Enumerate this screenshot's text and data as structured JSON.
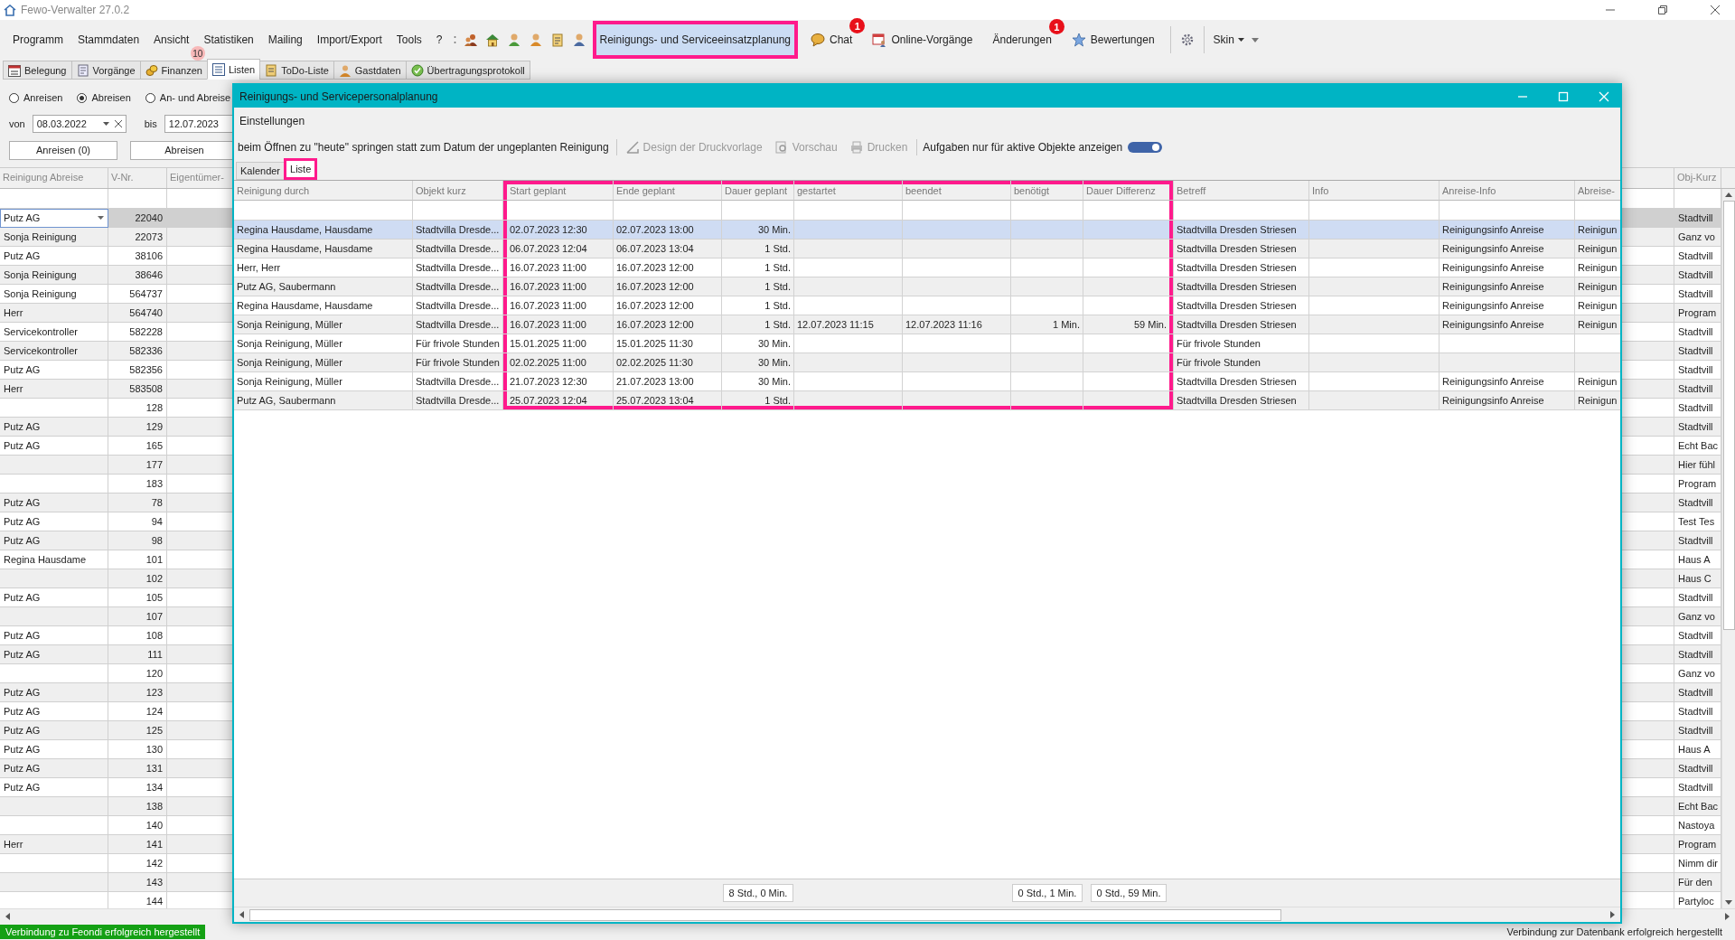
{
  "window": {
    "title": "Fewo-Verwalter 27.0.2"
  },
  "menu": [
    "Programm",
    "Stammdaten",
    "Ansicht",
    "Statistiken",
    "Mailing",
    "Import/Export",
    "Tools",
    "?"
  ],
  "tool_buttons": [
    {
      "label": "Reinigungs- und Serviceeinsatzplanung",
      "selected": true,
      "highlighted": true
    },
    {
      "label": "Chat",
      "selected": false,
      "highlighted": false,
      "badge": "1"
    },
    {
      "label": "Online-Vorgänge",
      "selected": false,
      "highlighted": false
    },
    {
      "label": "Änderungen",
      "selected": false,
      "highlighted": false,
      "badge": "1"
    },
    {
      "label": "Bewertungen",
      "selected": false,
      "highlighted": false
    }
  ],
  "skin": "Skin",
  "tabs": [
    {
      "label": "Belegung",
      "selected": false
    },
    {
      "label": "Vorgänge",
      "selected": false
    },
    {
      "label": "Finanzen",
      "selected": false,
      "badge": "10"
    },
    {
      "label": "Listen",
      "selected": true
    },
    {
      "label": "ToDo-Liste",
      "selected": false
    },
    {
      "label": "Gastdaten",
      "selected": false
    },
    {
      "label": "Übertragungsprotokoll",
      "selected": false
    }
  ],
  "filter": {
    "radios": [
      {
        "label": "Anreisen",
        "selected": false
      },
      {
        "label": "Abreisen",
        "selected": true
      },
      {
        "label": "An- und Abreise",
        "selected": false
      }
    ],
    "from_label": "von",
    "from": "08.03.2022",
    "to_label": "bis",
    "to": "12.07.2023",
    "buttons": [
      "Anreisen (0)",
      "Abreisen"
    ]
  },
  "list": {
    "columns": [
      "Reinigung Abreise",
      "V-Nr.",
      "Eigentümer-",
      "Obj-Kurz"
    ],
    "rows": [
      {
        "reinigung": "Putz AG",
        "v_nr": "22040",
        "obj_kurz": "Stadtvill",
        "selected": true
      },
      {
        "reinigung": "Sonja Reinigung",
        "v_nr": "22073",
        "obj_kurz": "Ganz vo",
        "selected": false
      },
      {
        "reinigung": "Putz AG",
        "v_nr": "38106",
        "obj_kurz": "Stadtvill",
        "selected": false
      },
      {
        "reinigung": "Sonja Reinigung",
        "v_nr": "38646",
        "obj_kurz": "Stadtvill",
        "selected": false
      },
      {
        "reinigung": "Sonja Reinigung",
        "v_nr": "564737",
        "obj_kurz": "Stadtvill",
        "selected": false
      },
      {
        "reinigung": "Herr",
        "v_nr": "564740",
        "obj_kurz": "Program",
        "selected": false
      },
      {
        "reinigung": "Servicekontroller",
        "v_nr": "582228",
        "obj_kurz": "Stadtvill",
        "selected": false
      },
      {
        "reinigung": "Servicekontroller",
        "v_nr": "582336",
        "obj_kurz": "Stadtvill",
        "selected": false
      },
      {
        "reinigung": "Putz AG",
        "v_nr": "582356",
        "obj_kurz": "Stadtvill",
        "selected": false
      },
      {
        "reinigung": "Herr",
        "v_nr": "583508",
        "obj_kurz": "Stadtvill",
        "selected": false
      },
      {
        "v_nr": "128",
        "obj_kurz": "Stadtvill",
        "selected": false
      },
      {
        "reinigung": "Putz AG",
        "v_nr": "129",
        "obj_kurz": "Stadtvill",
        "selected": false
      },
      {
        "reinigung": "Putz AG",
        "v_nr": "165",
        "obj_kurz": "Echt Bac",
        "selected": false
      },
      {
        "v_nr": "177",
        "obj_kurz": "Hier fühl",
        "selected": false
      },
      {
        "v_nr": "183",
        "obj_kurz": "Program",
        "selected": false
      },
      {
        "reinigung": "Putz AG",
        "v_nr": "78",
        "obj_kurz": "Stadtvill",
        "selected": false
      },
      {
        "reinigung": "Putz AG",
        "v_nr": "94",
        "obj_kurz": "Test Tes",
        "selected": false
      },
      {
        "reinigung": "Putz AG",
        "v_nr": "98",
        "obj_kurz": "Stadtvill",
        "selected": false
      },
      {
        "reinigung": "Regina Hausdame",
        "v_nr": "101",
        "obj_kurz": "Haus A",
        "selected": false
      },
      {
        "v_nr": "102",
        "obj_kurz": "Haus C",
        "selected": false
      },
      {
        "reinigung": "Putz AG",
        "v_nr": "105",
        "obj_kurz": "Stadtvill",
        "selected": false
      },
      {
        "v_nr": "107",
        "obj_kurz": "Ganz vo",
        "selected": false
      },
      {
        "reinigung": "Putz AG",
        "v_nr": "108",
        "obj_kurz": "Stadtvill",
        "selected": false
      },
      {
        "reinigung": "Putz AG",
        "v_nr": "111",
        "obj_kurz": "Stadtvill",
        "selected": false
      },
      {
        "v_nr": "120",
        "obj_kurz": "Ganz vo",
        "selected": false
      },
      {
        "reinigung": "Putz AG",
        "v_nr": "123",
        "obj_kurz": "Stadtvill",
        "selected": false
      },
      {
        "reinigung": "Putz AG",
        "v_nr": "124",
        "obj_kurz": "Stadtvill",
        "selected": false
      },
      {
        "reinigung": "Putz AG",
        "v_nr": "125",
        "obj_kurz": "Stadtvill",
        "selected": false
      },
      {
        "reinigung": "Putz AG",
        "v_nr": "130",
        "obj_kurz": "Haus A",
        "selected": false
      },
      {
        "reinigung": "Putz AG",
        "v_nr": "131",
        "obj_kurz": "Stadtvill",
        "selected": false
      },
      {
        "reinigung": "Putz AG",
        "v_nr": "134",
        "obj_kurz": "Stadtvill",
        "selected": false
      },
      {
        "v_nr": "138",
        "obj_kurz": "Echt Bac",
        "selected": false
      },
      {
        "v_nr": "140",
        "obj_kurz": "Nastoya",
        "selected": false
      },
      {
        "reinigung": "Herr",
        "v_nr": "141",
        "obj_kurz": "Program",
        "selected": false
      },
      {
        "v_nr": "142",
        "obj_kurz": "Nimm dir",
        "selected": false
      },
      {
        "v_nr": "143",
        "obj_kurz": "Für den",
        "selected": false
      },
      {
        "v_nr": "144",
        "obj_kurz": "Partyloc",
        "selected": false
      }
    ]
  },
  "dialog": {
    "title": "Reinigungs- und Servicepersonalplanung",
    "menu": [
      "Einstellungen"
    ],
    "jump_button": "beim Öffnen zu \"heute\" springen statt zum Datum der ungeplanten Reinigung",
    "print_buttons": [
      {
        "label": "Design der Druckvorlage",
        "disabled": true
      },
      {
        "label": "Vorschau",
        "disabled": true
      },
      {
        "label": "Drucken",
        "disabled": true
      }
    ],
    "active_switch": {
      "label": "Aufgaben nur für aktive Objekte anzeigen",
      "on": true
    },
    "tabs": [
      {
        "label": "Kalender",
        "selected": false,
        "highlighted": false
      },
      {
        "label": "Liste",
        "selected": true,
        "highlighted": true
      }
    ],
    "columns": [
      {
        "label": "Reinigung durch",
        "highlighted": false
      },
      {
        "label": "Objekt kurz",
        "highlighted": false
      },
      {
        "label": "Start geplant",
        "highlighted": true
      },
      {
        "label": "Ende geplant",
        "highlighted": true
      },
      {
        "label": "Dauer geplant",
        "highlighted": true,
        "total": "8 Std., 0 Min."
      },
      {
        "label": "gestartet",
        "highlighted": true
      },
      {
        "label": "beendet",
        "highlighted": true
      },
      {
        "label": "benötigt",
        "highlighted": true,
        "total": "0 Std., 1 Min."
      },
      {
        "label": "Dauer Differenz",
        "highlighted": true,
        "total": "0 Std., 59 Min."
      },
      {
        "label": "Betreff",
        "highlighted": false
      },
      {
        "label": "Info",
        "highlighted": false
      },
      {
        "label": "Anreise-Info",
        "highlighted": false
      },
      {
        "label": "Abreise-",
        "highlighted": false
      }
    ],
    "rows": [
      {
        "selected": true,
        "cells": [
          "Regina Hausdame, Hausdame",
          "Stadtvilla Dresde...",
          "02.07.2023 12:30",
          "02.07.2023 13:00",
          "30 Min.",
          null,
          null,
          null,
          null,
          "Stadtvilla Dresden Striesen",
          null,
          "Reinigungsinfo Anreise",
          "Reinigun"
        ]
      },
      {
        "selected": false,
        "cells": [
          "Regina Hausdame, Hausdame",
          "Stadtvilla Dresde...",
          "06.07.2023 12:04",
          "06.07.2023 13:04",
          "1 Std.",
          null,
          null,
          null,
          null,
          "Stadtvilla Dresden Striesen",
          null,
          "Reinigungsinfo Anreise",
          "Reinigun"
        ]
      },
      {
        "selected": false,
        "cells": [
          "Herr, Herr",
          "Stadtvilla Dresde...",
          "16.07.2023 11:00",
          "16.07.2023 12:00",
          "1 Std.",
          null,
          null,
          null,
          null,
          "Stadtvilla Dresden Striesen",
          null,
          "Reinigungsinfo Anreise",
          "Reinigun"
        ]
      },
      {
        "selected": false,
        "cells": [
          "Putz AG, Saubermann",
          "Stadtvilla Dresde...",
          "16.07.2023 11:00",
          "16.07.2023 12:00",
          "1 Std.",
          null,
          null,
          null,
          null,
          "Stadtvilla Dresden Striesen",
          null,
          "Reinigungsinfo Anreise",
          "Reinigun"
        ]
      },
      {
        "selected": false,
        "cells": [
          "Regina Hausdame, Hausdame",
          "Stadtvilla Dresde...",
          "16.07.2023 11:00",
          "16.07.2023 12:00",
          "1 Std.",
          null,
          null,
          null,
          null,
          "Stadtvilla Dresden Striesen",
          null,
          "Reinigungsinfo Anreise",
          "Reinigun"
        ]
      },
      {
        "selected": false,
        "cells": [
          "Sonja Reinigung, Müller",
          "Stadtvilla Dresde...",
          "16.07.2023 11:00",
          "16.07.2023 12:00",
          "1 Std.",
          "12.07.2023 11:15",
          "12.07.2023 11:16",
          "1 Min.",
          "59 Min.",
          "Stadtvilla Dresden Striesen",
          null,
          "Reinigungsinfo Anreise",
          "Reinigun"
        ]
      },
      {
        "selected": false,
        "cells": [
          "Sonja Reinigung, Müller",
          "Für frivole Stunden",
          "15.01.2025 11:00",
          "15.01.2025 11:30",
          "30 Min.",
          null,
          null,
          null,
          null,
          "Für frivole Stunden",
          null,
          null,
          null
        ]
      },
      {
        "selected": false,
        "cells": [
          "Sonja Reinigung, Müller",
          "Für frivole Stunden",
          "02.02.2025 11:00",
          "02.02.2025 11:30",
          "30 Min.",
          null,
          null,
          null,
          null,
          "Für frivole Stunden",
          null,
          null,
          null
        ]
      },
      {
        "selected": false,
        "cells": [
          "Sonja Reinigung, Müller",
          "Stadtvilla Dresde...",
          "21.07.2023 12:30",
          "21.07.2023 13:00",
          "30 Min.",
          null,
          null,
          null,
          null,
          "Stadtvilla Dresden Striesen",
          null,
          "Reinigungsinfo Anreise",
          "Reinigun"
        ]
      },
      {
        "selected": false,
        "cells": [
          "Putz AG, Saubermann",
          "Stadtvilla Dresde...",
          "25.07.2023 12:04",
          "25.07.2023 13:04",
          "1 Std.",
          null,
          null,
          null,
          null,
          "Stadtvilla Dresden Striesen",
          null,
          "Reinigungsinfo Anreise",
          "Reinigun"
        ]
      }
    ]
  },
  "status_bar": {
    "left": "Verbindung zu Feondi erfolgreich hergestellt",
    "right": "Verbindung zur Datenbank erfolgreich hergestellt"
  }
}
